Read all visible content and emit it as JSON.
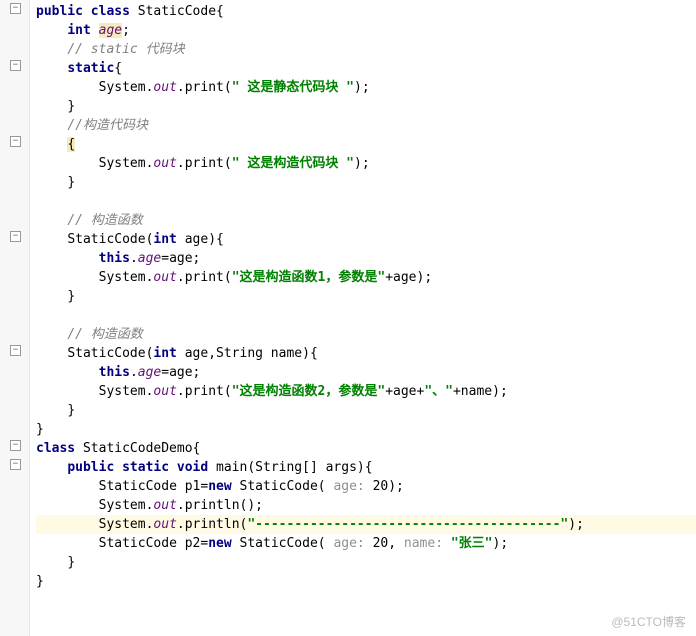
{
  "lines": {
    "l1_kw1": "public class ",
    "l1_name": "StaticCode{",
    "l2_kw": "int ",
    "l2_field": "age",
    "l2_end": ";",
    "l3_comment": "// static 代码块",
    "l4_kw": "static",
    "l4_end": "{",
    "l5_a": "System.",
    "l5_b": "out",
    "l5_c": ".print(",
    "l5_str": "\" 这是静态代码块 \"",
    "l5_d": ");",
    "l6": "}",
    "l7_comment": "//构造代码块",
    "l8": "{",
    "l9_a": "System.",
    "l9_b": "out",
    "l9_c": ".print(",
    "l9_str": "\" 这是构造代码块 \"",
    "l9_d": ");",
    "l10": "}",
    "l11": "",
    "l12_comment": "// 构造函数",
    "l13_a": "StaticCode(",
    "l13_kw": "int ",
    "l13_b": "age){",
    "l14_kw": "this",
    "l14_a": ".",
    "l14_field": "age",
    "l14_b": "=age;",
    "l15_a": "System.",
    "l15_b": "out",
    "l15_c": ".print(",
    "l15_str": "\"这是构造函数1，参数是\"",
    "l15_d": "+age);",
    "l16": "}",
    "l17": "",
    "l18_comment": "// 构造函数",
    "l19_a": "StaticCode(",
    "l19_kw1": "int ",
    "l19_b": "age,String name){",
    "l20_kw": "this",
    "l20_a": ".",
    "l20_field": "age",
    "l20_b": "=age;",
    "l21_a": "System.",
    "l21_b": "out",
    "l21_c": ".print(",
    "l21_str": "\"这是构造函数2，参数是\"",
    "l21_d": "+age+",
    "l21_str2": "\"、\"",
    "l21_e": "+name);",
    "l22": "}",
    "l23": "}",
    "l24_kw": "class ",
    "l24_name": "StaticCodeDemo{",
    "l25_kw": "public static void ",
    "l25_name": "main(String[] args){",
    "l26_a": "StaticCode p1=",
    "l26_kw": "new ",
    "l26_b": "StaticCode( ",
    "l26_hint": "age: ",
    "l26_c": "20);",
    "l27_a": "System.",
    "l27_b": "out",
    "l27_c": ".println();",
    "l28_a": "System.",
    "l28_b": "out",
    "l28_c": ".println(",
    "l28_str": "\"---------------------------------------\"",
    "l28_d": ");",
    "l29_a": "StaticCode p2=",
    "l29_kw": "new ",
    "l29_b": "StaticCode( ",
    "l29_hint1": "age: ",
    "l29_c": "20, ",
    "l29_hint2": "name: ",
    "l29_str": "\"张三\"",
    "l29_d": ");",
    "l30": "}",
    "l31": "}"
  },
  "watermark": "@51CTO博客"
}
